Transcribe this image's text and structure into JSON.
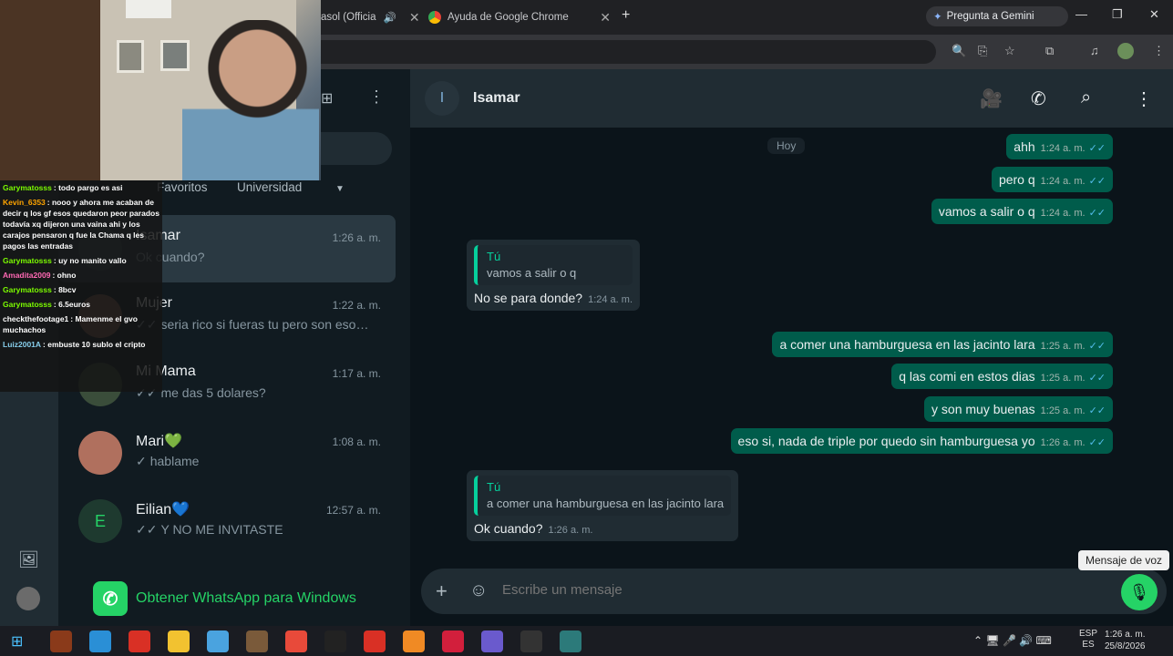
{
  "browser": {
    "tabs": [
      {
        "title": "asol (Officia",
        "audio": true
      },
      {
        "title": "Ayuda de Google Chrome"
      }
    ],
    "gemini_label": "Pregunta a Gemini"
  },
  "whatsapp": {
    "filters": [
      "Favoritos",
      "Universidad"
    ],
    "chats": [
      {
        "name": "Isamar",
        "time": "1:26 a. m.",
        "preview": "Ok cuando?",
        "ticks": "",
        "active": true,
        "avatar_color": "#3b4a54"
      },
      {
        "name": "Mujer",
        "time": "1:22 a. m.",
        "preview": "seria rico si fueras tu pero son esos c...",
        "ticks": "✓✓",
        "avatar_color": "#7a5a4a"
      },
      {
        "name": "Mi Mama",
        "time": "1:17 a. m.",
        "preview": "me das 5 dolares?",
        "ticks": "✓✓",
        "avatar_color": "#3a4d3a"
      },
      {
        "name": "Mari💚",
        "time": "1:08 a. m.",
        "preview": "hablame",
        "ticks": "✓",
        "avatar_color": "#b0705e"
      },
      {
        "name": "Eilian💙",
        "time": "12:57 a. m.",
        "preview": "Y NO ME INVITASTE",
        "ticks": "✓✓",
        "avatar_letter": "E",
        "avatar_color": "#1e3a2f"
      }
    ],
    "get_app_text": "Obtener WhatsApp para Windows",
    "conversation": {
      "contact": "Isamar",
      "avatar_letter": "I",
      "day": "Hoy",
      "messages": [
        {
          "dir": "out",
          "text": "ahh",
          "time": "1:24 a. m."
        },
        {
          "dir": "out",
          "text": "pero q",
          "time": "1:24 a. m."
        },
        {
          "dir": "out",
          "text": "vamos a salir o q",
          "time": "1:24 a. m."
        },
        {
          "dir": "in",
          "quote_author": "Tú",
          "quote_text": "vamos a salir o q",
          "text": "No se para donde?",
          "time": "1:24 a. m."
        },
        {
          "dir": "out",
          "text": "a comer una hamburguesa en las jacinto lara",
          "time": "1:25 a. m."
        },
        {
          "dir": "out",
          "text": "q las comi en estos dias",
          "time": "1:25 a. m."
        },
        {
          "dir": "out",
          "text": "y son muy buenas",
          "time": "1:25 a. m."
        },
        {
          "dir": "out",
          "text": "eso si, nada de triple por quedo sin hamburguesa yo",
          "time": "1:26 a. m."
        },
        {
          "dir": "in",
          "quote_author": "Tú",
          "quote_text": "a comer una hamburguesa en las jacinto lara",
          "text": "Ok cuando?",
          "time": "1:26 a. m."
        }
      ],
      "input_placeholder": "Escribe un mensaje",
      "tooltip": "Mensaje de voz"
    }
  },
  "stream_chat": [
    {
      "user": "Garymatosss",
      "text": ": todo pargo es asi",
      "color": "#7cfc00"
    },
    {
      "user": "Kevin_6353",
      "text": ": nooo y ahora me acaban de decir q los gf esos quedaron peor parados todavía xq dijeron una vaina ahi y los carajos pensaron q fue la Chama q les pagos las entradas",
      "color": "#ffa500"
    },
    {
      "user": "Garymatosss",
      "text": ": uy no manito vallo",
      "color": "#7cfc00"
    },
    {
      "user": "Amadita2009",
      "text": ": ohno",
      "color": "#ff69b4"
    },
    {
      "user": "Garymatosss",
      "text": ": 8bcv",
      "color": "#7cfc00"
    },
    {
      "user": "Garymatosss",
      "text": ": 6.5euros",
      "color": "#7cfc00"
    },
    {
      "user": "checkthefootage1",
      "text": ": Mamenme el gvo muchachos",
      "color": "#ffffff"
    },
    {
      "user": "Luiz2001A",
      "text": ": embuste 10 sublo el cripto",
      "color": "#87ceeb"
    }
  ],
  "taskbar": {
    "ime": [
      "ESP",
      "ES"
    ],
    "time": "1:26 a. m.",
    "date": "25/8/2026",
    "apps": [
      "#8a3a1a",
      "#2a8fd6",
      "#d93025",
      "#f2c230",
      "#4aa3df",
      "#7a5a3a",
      "#e84a3a",
      "#222222",
      "#d93025",
      "#f08a24",
      "#d21f3c",
      "#6a5acd",
      "#333333",
      "#2c7a7a"
    ]
  }
}
